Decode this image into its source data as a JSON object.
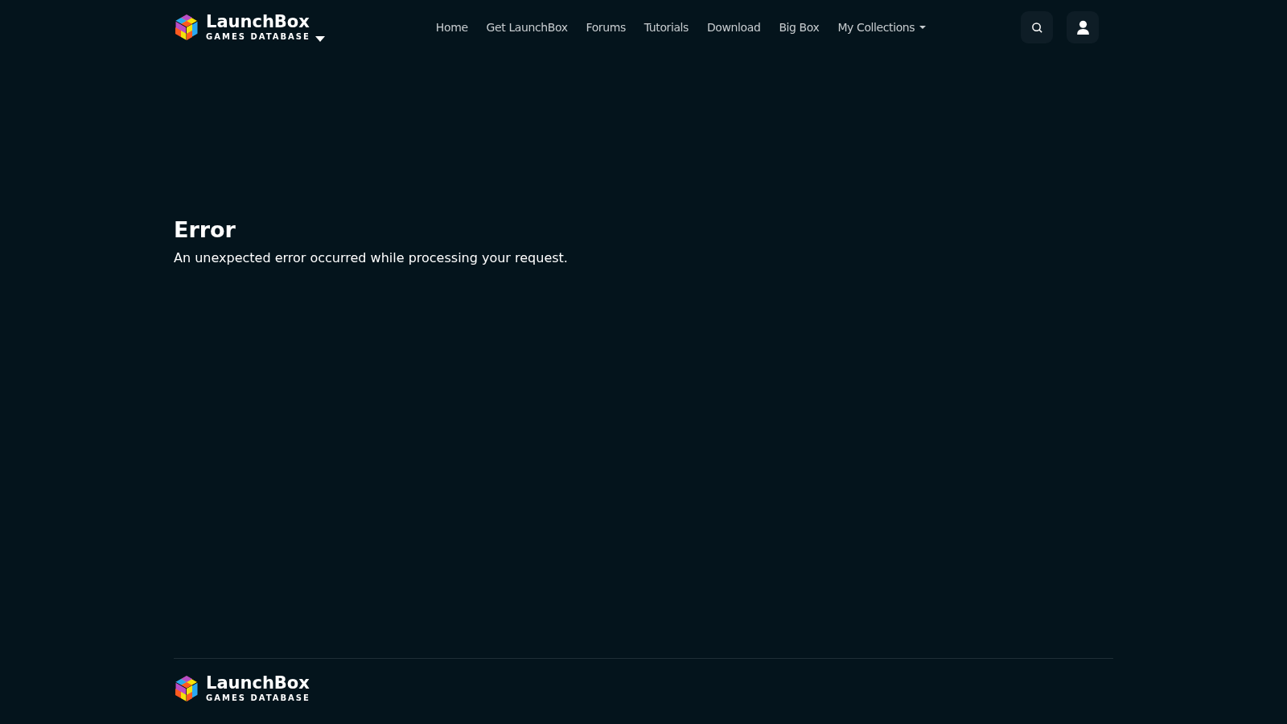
{
  "header": {
    "logo": {
      "title": "LaunchBox",
      "subtitle": "GAMES DATABASE"
    },
    "nav": [
      {
        "label": "Home",
        "dropdown": false
      },
      {
        "label": "Get LaunchBox",
        "dropdown": false
      },
      {
        "label": "Forums",
        "dropdown": false
      },
      {
        "label": "Tutorials",
        "dropdown": false
      },
      {
        "label": "Download",
        "dropdown": false
      },
      {
        "label": "Big Box",
        "dropdown": false
      },
      {
        "label": "My Collections",
        "dropdown": true
      }
    ]
  },
  "main": {
    "heading": "Error",
    "message": "An unexpected error occurred while processing your request."
  },
  "footer": {
    "logo": {
      "title": "LaunchBox",
      "subtitle": "GAMES DATABASE"
    }
  }
}
